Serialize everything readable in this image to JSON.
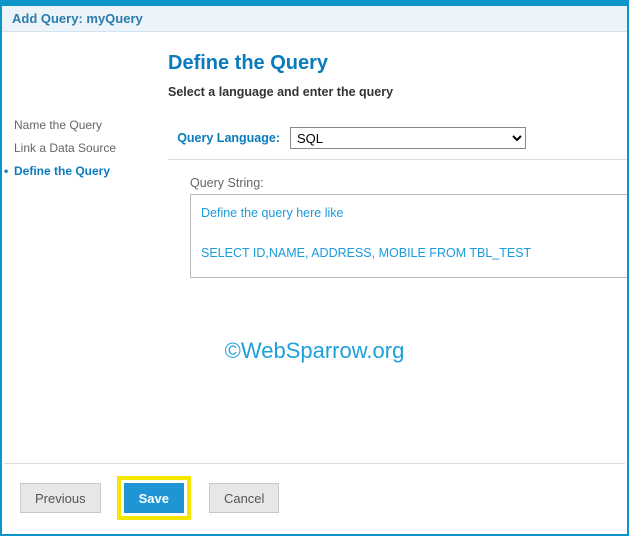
{
  "window": {
    "title": "Add Query: myQuery"
  },
  "sidebar": {
    "steps": [
      {
        "label": "Name the Query",
        "active": false
      },
      {
        "label": "Link a Data Source",
        "active": false
      },
      {
        "label": "Define the Query",
        "active": true
      }
    ]
  },
  "main": {
    "heading": "Define the Query",
    "subtitle": "Select a language and enter the query",
    "language_label": "Query Language:",
    "language_value": "SQL",
    "query_string_label": "Query String:",
    "query_text": "Define the query here like\n\nSELECT ID,NAME, ADDRESS, MOBILE FROM TBL_TEST"
  },
  "watermark": "©WebSparrow.org",
  "footer": {
    "previous": "Previous",
    "save": "Save",
    "cancel": "Cancel"
  }
}
